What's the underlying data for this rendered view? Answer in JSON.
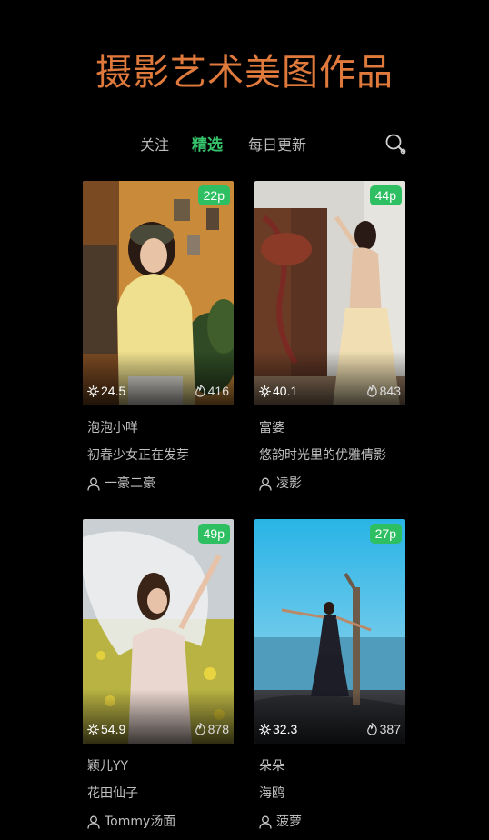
{
  "page": {
    "title": "摄影艺术美图作品",
    "accent_title": "#e07a3c",
    "accent_active": "#35c46b"
  },
  "tabs": [
    {
      "label": "关注",
      "active": false
    },
    {
      "label": "精选",
      "active": true
    },
    {
      "label": "每日更新",
      "active": false
    }
  ],
  "search": {
    "icon": "search-icon"
  },
  "cards": [
    {
      "count": "22p",
      "rating": "24.5",
      "views": "416",
      "name": "泡泡小咩",
      "desc": "初春少女正在发芽",
      "author": "一豪二豪"
    },
    {
      "count": "44p",
      "rating": "40.1",
      "views": "843",
      "name": "富婆",
      "desc": "悠韵时光里的优雅倩影",
      "author": "凌影"
    },
    {
      "count": "49p",
      "rating": "54.9",
      "views": "878",
      "name": "颖儿YY",
      "desc": "花田仙子",
      "author": "Tommy汤面"
    },
    {
      "count": "27p",
      "rating": "32.3",
      "views": "387",
      "name": "朵朵",
      "desc": "海鸥",
      "author": "菠萝"
    }
  ],
  "icons": {
    "rating": "sun-icon",
    "views": "flame-icon",
    "author": "user-icon"
  },
  "badge_color": "#2fbf63"
}
